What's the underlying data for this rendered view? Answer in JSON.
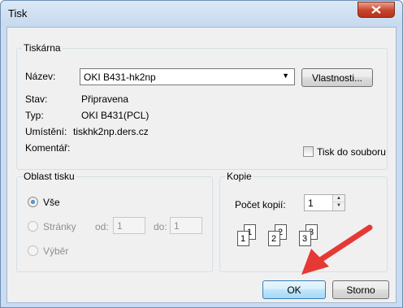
{
  "window": {
    "title": "Tisk"
  },
  "printer_group": {
    "legend": "Tiskárna",
    "name_label": "Název:",
    "name_value": "OKI B431-hk2np",
    "properties_button": "Vlastnosti...",
    "status_label": "Stav:",
    "status_value": "Připravena",
    "type_label": "Typ:",
    "type_value": "OKI B431(PCL)",
    "location_label": "Umístění:",
    "location_value": "tiskhk2np.ders.cz",
    "comment_label": "Komentář:",
    "print_to_file_label": "Tisk do souboru"
  },
  "range_group": {
    "legend": "Oblast tisku",
    "all_label": "Vše",
    "pages_label": "Stránky",
    "from_label": "od:",
    "from_value": "1",
    "to_label": "do:",
    "to_value": "1",
    "selection_label": "Výběr"
  },
  "copies_group": {
    "legend": "Kopie",
    "count_label": "Počet kopií:",
    "count_value": "1",
    "collate_pages": [
      {
        "front": "1",
        "back": "1"
      },
      {
        "front": "2",
        "back": "2"
      },
      {
        "front": "3",
        "back": "3"
      }
    ]
  },
  "buttons": {
    "ok": "OK",
    "cancel": "Storno"
  },
  "colors": {
    "annotation_arrow": "#e53935",
    "accent": "#3c7fb1",
    "close_button": "#c7432c"
  }
}
